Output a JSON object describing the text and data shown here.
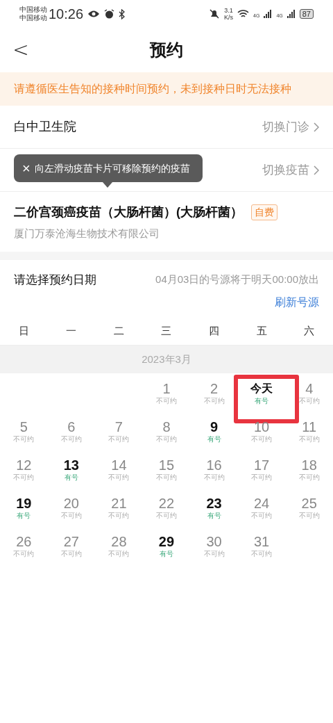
{
  "status_bar": {
    "carriers": [
      "中国移动",
      "中国移动"
    ],
    "time": "10:26",
    "speed": [
      "3.1",
      "K/s"
    ],
    "network": [
      "4G",
      "4G"
    ],
    "battery": "87"
  },
  "header": {
    "back": "<",
    "title": "预约"
  },
  "notice": "请遵循医生告知的接种时间预约，未到接种日时无法接种",
  "rows": [
    {
      "label": "白中卫生院",
      "action": "切换门诊"
    },
    {
      "action": "切换疫苗"
    }
  ],
  "tooltip": {
    "close": "×",
    "text": "向左滑动疫苗卡片可移除预约的疫苗"
  },
  "vaccine": {
    "name": "二价宫颈癌疫苗（大肠杆菌）(大肠杆菌）",
    "tag": "自费",
    "maker": "厦门万泰沧海生物技术有限公司"
  },
  "date_section": {
    "label": "请选择预约日期",
    "note": "04月03日的号源将于明天00:00放出",
    "refresh": "刷新号源"
  },
  "weekdays": [
    "日",
    "一",
    "二",
    "三",
    "四",
    "五",
    "六"
  ],
  "month": "2023年3月",
  "days": [
    {
      "kind": "blank"
    },
    {
      "kind": "blank"
    },
    {
      "kind": "blank"
    },
    {
      "kind": "day",
      "label": "1",
      "status": "不可约",
      "available": false
    },
    {
      "kind": "day",
      "label": "2",
      "status": "不可约",
      "available": false
    },
    {
      "kind": "day",
      "label": "今天",
      "status": "有号",
      "available": true,
      "highlighted": true
    },
    {
      "kind": "day",
      "label": "4",
      "status": "不可约",
      "available": false
    },
    {
      "kind": "day",
      "label": "5",
      "status": "不可约",
      "available": false
    },
    {
      "kind": "day",
      "label": "6",
      "status": "不可约",
      "available": false
    },
    {
      "kind": "day",
      "label": "7",
      "status": "不可约",
      "available": false
    },
    {
      "kind": "day",
      "label": "8",
      "status": "不可约",
      "available": false
    },
    {
      "kind": "day",
      "label": "9",
      "status": "有号",
      "available": true
    },
    {
      "kind": "day",
      "label": "10",
      "status": "不可约",
      "available": false
    },
    {
      "kind": "day",
      "label": "11",
      "status": "不可约",
      "available": false
    },
    {
      "kind": "day",
      "label": "12",
      "status": "不可约",
      "available": false
    },
    {
      "kind": "day",
      "label": "13",
      "status": "有号",
      "available": true
    },
    {
      "kind": "day",
      "label": "14",
      "status": "不可约",
      "available": false
    },
    {
      "kind": "day",
      "label": "15",
      "status": "不可约",
      "available": false
    },
    {
      "kind": "day",
      "label": "16",
      "status": "不可约",
      "available": false
    },
    {
      "kind": "day",
      "label": "17",
      "status": "不可约",
      "available": false
    },
    {
      "kind": "day",
      "label": "18",
      "status": "不可约",
      "available": false
    },
    {
      "kind": "day",
      "label": "19",
      "status": "有号",
      "available": true
    },
    {
      "kind": "day",
      "label": "20",
      "status": "不可约",
      "available": false
    },
    {
      "kind": "day",
      "label": "21",
      "status": "不可约",
      "available": false
    },
    {
      "kind": "day",
      "label": "22",
      "status": "不可约",
      "available": false
    },
    {
      "kind": "day",
      "label": "23",
      "status": "有号",
      "available": true
    },
    {
      "kind": "day",
      "label": "24",
      "status": "不可约",
      "available": false
    },
    {
      "kind": "day",
      "label": "25",
      "status": "不可约",
      "available": false
    },
    {
      "kind": "day",
      "label": "26",
      "status": "不可约",
      "available": false
    },
    {
      "kind": "day",
      "label": "27",
      "status": "不可约",
      "available": false
    },
    {
      "kind": "day",
      "label": "28",
      "status": "不可约",
      "available": false
    },
    {
      "kind": "day",
      "label": "29",
      "status": "有号",
      "available": true
    },
    {
      "kind": "day",
      "label": "30",
      "status": "不可约",
      "available": false
    },
    {
      "kind": "day",
      "label": "31",
      "status": "不可约",
      "available": false
    }
  ]
}
